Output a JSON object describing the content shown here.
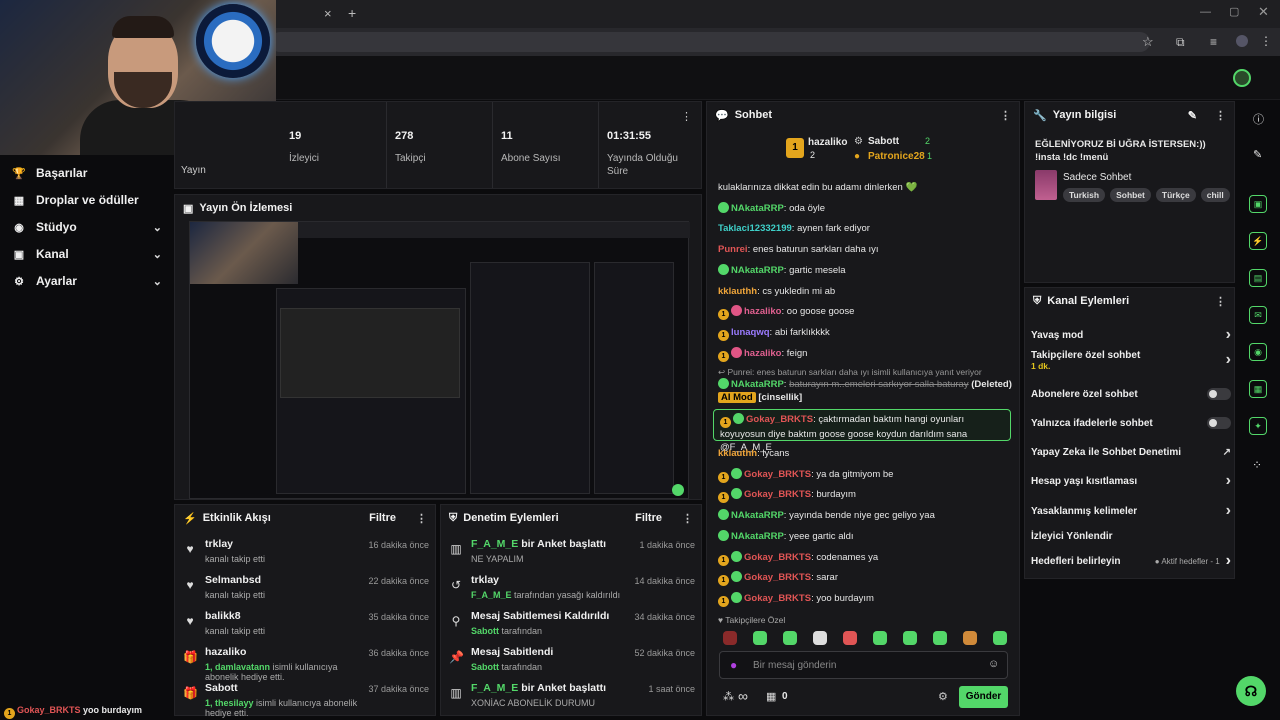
{
  "browser": {
    "tab_close": "×",
    "tab_new": "+"
  },
  "nav": [
    {
      "icon": "trophy-icon",
      "glyph": "🏆",
      "label": "Başarılar",
      "chev": ""
    },
    {
      "icon": "gift-icon",
      "glyph": "▦",
      "label": "Droplar ve ödüller",
      "chev": ""
    },
    {
      "icon": "studio-icon",
      "glyph": "◉",
      "label": "Stüdyo",
      "chev": "⌄"
    },
    {
      "icon": "channel-icon",
      "glyph": "▣",
      "label": "Kanal",
      "chev": "⌄"
    },
    {
      "icon": "settings-icon",
      "glyph": "⚙",
      "label": "Ayarlar",
      "chev": "⌄"
    }
  ],
  "stats": {
    "title": "Yayın",
    "items": [
      {
        "value": "19",
        "label": "İzleyici"
      },
      {
        "value": "278",
        "label": "Takipçi"
      },
      {
        "value": "11",
        "label": "Abone Sayısı"
      },
      {
        "value": "01:31:55",
        "label": "Yayında Olduğu Süre"
      }
    ]
  },
  "preview": {
    "title": "Yayın Ön İzlemesi"
  },
  "activity": {
    "title": "Etkinlik Akışı",
    "filter": "Filtre",
    "rows": [
      {
        "icon": "heart-icon",
        "glyph": "♥",
        "name": "trklay",
        "sub": "kanalı takip etti",
        "time": "16 dakika önce"
      },
      {
        "icon": "heart-icon",
        "glyph": "♥",
        "name": "Selmanbsd",
        "sub": "kanalı takip etti",
        "time": "22 dakika önce"
      },
      {
        "icon": "heart-icon",
        "glyph": "♥",
        "name": "balikk8",
        "sub": "kanalı takip etti",
        "time": "35 dakika önce"
      },
      {
        "icon": "gift-sub-icon",
        "glyph": "🎁",
        "name": "hazaliko",
        "sub_hl": "1, damlavatann",
        "sub": "isimli kullanıcıya abonelik hediye etti.",
        "time": "36 dakika önce"
      },
      {
        "icon": "gift-sub-icon",
        "glyph": "🎁",
        "name": "Sabott",
        "sub_hl": "1, thesilayy",
        "sub": "isimli kullanıcıya abonelik hediye etti.",
        "time": "37 dakika önce"
      }
    ]
  },
  "moderation": {
    "title": "Denetim Eylemleri",
    "filter": "Filtre",
    "rows": [
      {
        "icon": "poll-icon",
        "glyph": "▥",
        "name_hl": "F_A_M_E",
        "name": "bir Anket başlattı",
        "sub": "NE YAPALIM",
        "time": "1 dakika önce"
      },
      {
        "icon": "unban-icon",
        "glyph": "↺",
        "name": "trklay",
        "sub_hl": "F_A_M_E",
        "sub": "tarafından yasağı kaldırıldı",
        "time": "14 dakika önce"
      },
      {
        "icon": "unpin-icon",
        "glyph": "⚲",
        "name": "Mesaj Sabitlemesi Kaldırıldı",
        "sub_hl": "Sabott",
        "sub": "tarafından",
        "time": "34 dakika önce"
      },
      {
        "icon": "pin-icon",
        "glyph": "📌",
        "name": "Mesaj Sabitlendi",
        "sub_hl": "Sabott",
        "sub": "tarafından",
        "time": "52 dakika önce"
      },
      {
        "icon": "poll-icon",
        "glyph": "▥",
        "name_hl": "F_A_M_E",
        "name": "bir Anket başlattı",
        "sub": "XONİAC ABONELİK DURUMU",
        "time": "1 saat önce"
      }
    ]
  },
  "chat": {
    "title": "Sohbet",
    "leaders": [
      {
        "name": "hazaliko",
        "rank": "1",
        "count": "2"
      },
      {
        "name": "Sabott",
        "count": "2"
      },
      {
        "name": "Patronice28",
        "count": "1"
      }
    ],
    "messages": [
      {
        "nick": "",
        "color": "#e6e6e6",
        "text": "kulaklarınıza dikkat edin bu adamı dinlerken 💚",
        "badges": []
      },
      {
        "nick": "NAkataRRP",
        "color": "#53d769",
        "text": "oda öyle",
        "badges": [
          "green"
        ]
      },
      {
        "nick": "Taklaci12332199",
        "color": "#3fd0c9",
        "text": "aynen fark ediyor",
        "badges": []
      },
      {
        "nick": "Punrei",
        "color": "#e05555",
        "text": "enes baturun sarkları daha ıyı",
        "badges": []
      },
      {
        "nick": "NAkataRRP",
        "color": "#53d769",
        "text": "gartic mesela",
        "badges": [
          "green"
        ]
      },
      {
        "nick": "kklauthh",
        "color": "#f0a53a",
        "text": "cs yukledin mi ab",
        "badges": []
      },
      {
        "nick": "hazaliko",
        "color": "#e06090",
        "text": "oo goose goose",
        "badges": [
          "gold",
          "pink"
        ]
      },
      {
        "nick": "lunaqwq",
        "color": "#9b7bff",
        "text": "abi farklıkkkk",
        "badges": [
          "gold"
        ]
      },
      {
        "nick": "hazaliko",
        "color": "#e06090",
        "text": "feign",
        "badges": [
          "gold",
          "pink"
        ]
      }
    ],
    "reply_note": "Punrei: enes baturun sarkları daha ıyı isimli kullanıcıya yanıt veriyor",
    "deleted_nick": "NAkataRRP",
    "deleted_text": "baturayın m..emeleri sarkıyor salla baturay",
    "deleted_tag": "(Deleted)",
    "ai_tag": "AI Mod",
    "ai_reason": "[cinsellik]",
    "highlight_nick": "Gokay_BRKTS",
    "highlight_text": "çaktırmadan baktım hangi oyunları koyuyosun diye baktım goose goose koydun darıldım sana @F_A_M_E",
    "messages2": [
      {
        "nick": "kklauthh",
        "color": "#f0a53a",
        "text": "lycans",
        "badges": []
      },
      {
        "nick": "Gokay_BRKTS",
        "color": "#e05555",
        "text": "ya da gitmiyom be",
        "badges": [
          "gold",
          "green"
        ]
      },
      {
        "nick": "Gokay_BRKTS",
        "color": "#e05555",
        "text": "burdayım",
        "badges": [
          "gold",
          "green"
        ]
      },
      {
        "nick": "NAkataRRP",
        "color": "#53d769",
        "text": "yayında bende niye gec geliyo yaa",
        "badges": [
          "green"
        ]
      },
      {
        "nick": "NAkataRRP",
        "color": "#53d769",
        "text": "yeee gartic aldı",
        "badges": [
          "green"
        ]
      },
      {
        "nick": "Gokay_BRKTS",
        "color": "#e05555",
        "text": "codenames ya",
        "badges": [
          "gold",
          "green"
        ]
      },
      {
        "nick": "Gokay_BRKTS",
        "color": "#e05555",
        "text": "sarar",
        "badges": [
          "gold",
          "green"
        ]
      },
      {
        "nick": "Gokay_BRKTS",
        "color": "#e05555",
        "text": "yoo burdayım",
        "badges": [
          "gold",
          "green"
        ]
      }
    ],
    "followers_only": "Takipçilere Özel",
    "placeholder": "Bir mesaj gönderin",
    "infinity": "∞",
    "points": "0",
    "send": "Gönder"
  },
  "stream_info": {
    "title": "Yayın bilgisi",
    "text": "EĞLENİYORUZ Bİ UĞRA İSTERSEN:)) !insta !dc !menü",
    "category": "Sadece Sohbet",
    "tags": [
      "Turkish",
      "Sohbet",
      "Türkçe",
      "chill"
    ]
  },
  "channel_actions": {
    "title": "Kanal Eylemleri",
    "items": [
      {
        "label": "Yavaş mod",
        "kind": "chev"
      },
      {
        "label": "Takipçilere özel sohbet",
        "sub": "1 dk.",
        "kind": "chev"
      },
      {
        "label": "Abonelere özel sohbet",
        "kind": "toggle"
      },
      {
        "label": "Yalnızca ifadelerle sohbet",
        "kind": "toggle"
      },
      {
        "label": "Yapay Zeka ile Sohbet Denetimi",
        "kind": "ext"
      },
      {
        "label": "Hesap yaşı kısıtlaması",
        "kind": "chev"
      },
      {
        "label": "Yasaklanmış kelimeler",
        "kind": "chev"
      },
      {
        "label": "İzleyici Yönlendir",
        "kind": "none"
      },
      {
        "label": "Hedefleri belirleyin",
        "kind": "goal",
        "extra": "Aktif hedefler - 1"
      }
    ]
  },
  "overlay": {
    "nick": "Gokay_BRKTS",
    "text": "yoo burdayım",
    "rank": "1"
  },
  "colors": {
    "accent": "#53d769",
    "bg": "#0b0b0d",
    "panel": "#18181b"
  }
}
